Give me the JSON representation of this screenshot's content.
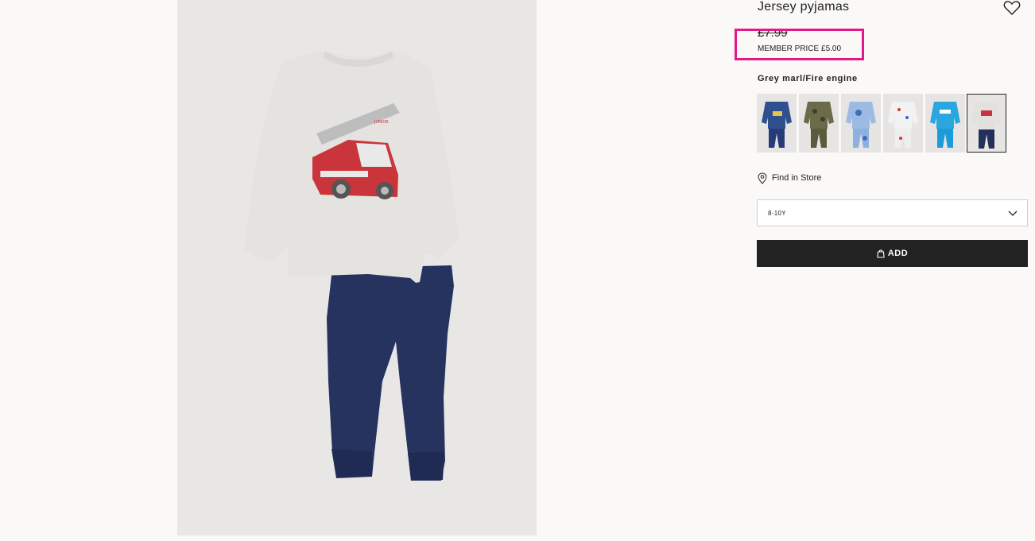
{
  "product": {
    "title": "Jersey pyjamas",
    "price": "£7.99",
    "member_price": "MEMBER PRICE £5.00",
    "color_name": "Grey marl/Fire engine",
    "main_image_icon": "pyjama-fire-engine-image"
  },
  "swatches": [
    {
      "name": "navy-dinosaur",
      "shirt": "#2f4f8f",
      "pants": "#2a3f7a"
    },
    {
      "name": "khaki-camo",
      "shirt": "#6b6a4a",
      "pants": "#5a5a3c"
    },
    {
      "name": "blue-camo",
      "shirt": "#9cbbe3",
      "pants": "#8eb0e0"
    },
    {
      "name": "white-print",
      "shirt": "#f2f2f2",
      "pants": "#f0f0f0"
    },
    {
      "name": "turquoise-print",
      "shirt": "#2aa7df",
      "pants": "#1e9bd6"
    },
    {
      "name": "grey-fire-engine",
      "shirt": "#e2e1dd",
      "pants": "#23305a"
    }
  ],
  "store": {
    "label": "Find in Store"
  },
  "size": {
    "selected": "8-10Y"
  },
  "cart": {
    "add_label": "ADD"
  },
  "colors": {
    "highlight": "#e1198b",
    "button_bg": "#222222"
  }
}
